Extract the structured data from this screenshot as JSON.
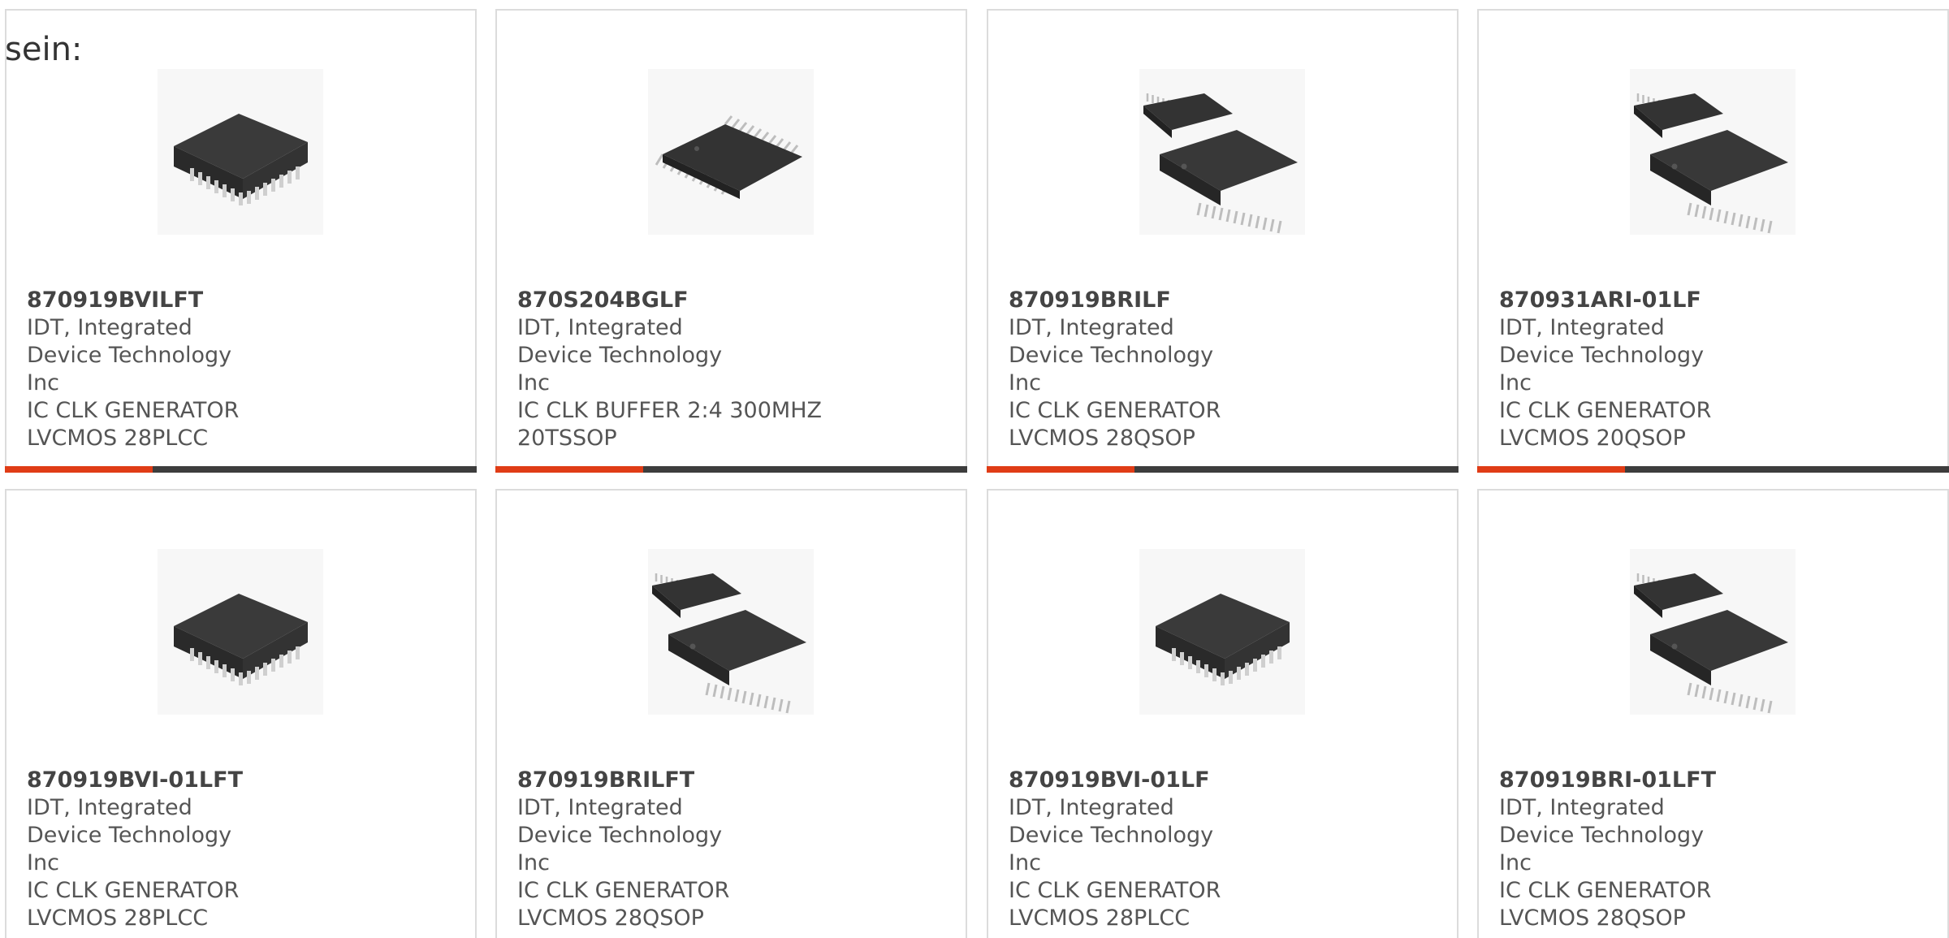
{
  "intro_text": "sein:",
  "accent_color": "#e03c16",
  "bar_color": "#3d3d3d",
  "products": [
    {
      "part_number": "870919BVILFT",
      "manufacturer": "IDT, Integrated Device Technology Inc",
      "description": "IC CLK GENERATOR LVCMOS 28PLCC",
      "image": "plcc-chip-icon"
    },
    {
      "part_number": "870S204BGLF",
      "manufacturer": "IDT, Integrated Device Technology Inc",
      "description": "IC CLK BUFFER 2:4 300MHZ 20TSSOP",
      "image": "tssop-chip-icon"
    },
    {
      "part_number": "870919BRILF",
      "manufacturer": "IDT, Integrated Device Technology Inc",
      "description": "IC CLK GENERATOR LVCMOS 28QSOP",
      "image": "qsop-chip-icon"
    },
    {
      "part_number": "870931ARI-01LF",
      "manufacturer": "IDT, Integrated Device Technology Inc",
      "description": "IC CLK GENERATOR LVCMOS 20QSOP",
      "image": "qsop-chip-icon"
    },
    {
      "part_number": "870919BVI-01LFT",
      "manufacturer": "IDT, Integrated Device Technology Inc",
      "description": "IC CLK GENERATOR LVCMOS 28PLCC",
      "image": "plcc-chip-icon"
    },
    {
      "part_number": "870919BRILFT",
      "manufacturer": "IDT, Integrated Device Technology Inc",
      "description": "IC CLK GENERATOR LVCMOS 28QSOP",
      "image": "qsop-chip-icon"
    },
    {
      "part_number": "870919BVI-01LF",
      "manufacturer": "IDT, Integrated Device Technology Inc",
      "description": "IC CLK GENERATOR LVCMOS 28PLCC",
      "image": "plcc-chip-icon"
    },
    {
      "part_number": "870919BRI-01LFT",
      "manufacturer": "IDT, Integrated Device Technology Inc",
      "description": "IC CLK GENERATOR LVCMOS 28QSOP",
      "image": "qsop-chip-icon"
    }
  ]
}
